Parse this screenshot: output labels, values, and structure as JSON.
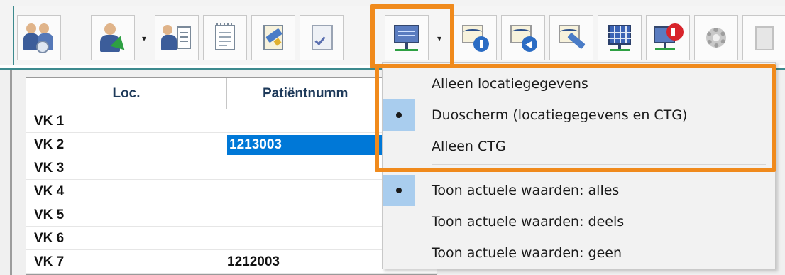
{
  "toolbar": {
    "buttons": [
      {
        "icon": "patients-group-icon"
      },
      {
        "icon": "patient-admit-icon",
        "has_dropdown": true
      },
      {
        "icon": "patient-record-icon"
      },
      {
        "icon": "notes-icon"
      },
      {
        "icon": "edit-document-icon"
      },
      {
        "icon": "checklist-icon"
      },
      {
        "icon": "monitor-view-icon",
        "has_dropdown": true,
        "highlighted": true
      },
      {
        "icon": "ctg-info-icon"
      },
      {
        "icon": "ctg-back-icon"
      },
      {
        "icon": "ctg-annotate-icon"
      },
      {
        "icon": "grid-monitor-icon"
      },
      {
        "icon": "alarm-speaker-icon"
      },
      {
        "icon": "settings-gear-icon"
      },
      {
        "icon": "disabled-doc-icon"
      }
    ],
    "dropdown_glyph": "▾"
  },
  "grid": {
    "columns": [
      "Loc.",
      "Patiëntnumm"
    ],
    "rows": [
      {
        "loc": "VK 1",
        "patient": ""
      },
      {
        "loc": "VK 2",
        "patient": "1213003",
        "selected": true
      },
      {
        "loc": "VK 3",
        "patient": ""
      },
      {
        "loc": "VK 4",
        "patient": ""
      },
      {
        "loc": "VK 5",
        "patient": ""
      },
      {
        "loc": "VK 6",
        "patient": ""
      },
      {
        "loc": "VK 7",
        "patient": "1212003"
      }
    ]
  },
  "menu": {
    "items": [
      {
        "label": "Alleen locatiegegevens",
        "checked": false
      },
      {
        "label": "Duoscherm (locatiegegevens en CTG)",
        "checked": true
      },
      {
        "label": "Alleen CTG",
        "checked": false
      },
      {
        "label": "Toon actuele waarden: alles",
        "checked": true
      },
      {
        "label": "Toon actuele waarden: deels",
        "checked": false
      },
      {
        "label": "Toon actuele waarden: geen",
        "checked": false
      }
    ]
  },
  "colors": {
    "highlight": "#f08a1c",
    "selection": "#0078d7",
    "checked_bg": "#a9cdee",
    "accent_line": "#3d8a8e"
  }
}
